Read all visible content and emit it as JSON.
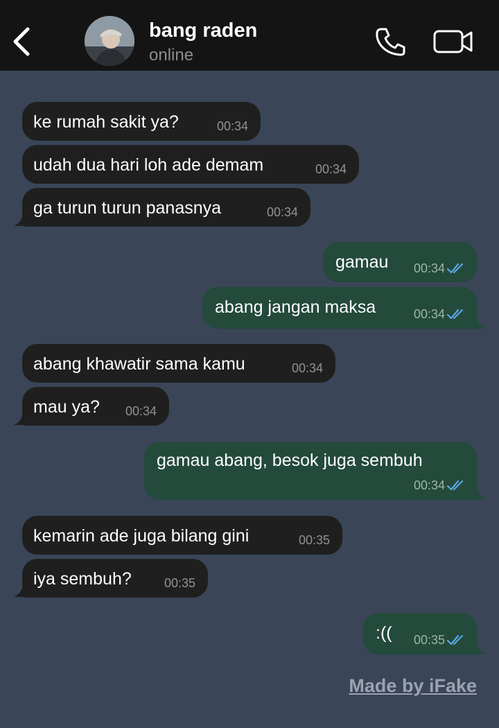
{
  "header": {
    "contact_name": "bang raden",
    "status": "online",
    "icons": [
      "chevron-left-icon",
      "phone-icon",
      "video-camera-icon"
    ]
  },
  "messages": [
    {
      "side": "in",
      "text": "ke rumah sakit ya?",
      "time": "00:34"
    },
    {
      "side": "in",
      "text": "udah dua hari loh ade demam",
      "time": "00:34"
    },
    {
      "side": "in",
      "text": "ga turun turun panasnya",
      "time": "00:34"
    },
    {
      "side": "out",
      "text": "gamau",
      "time": "00:34",
      "read": true
    },
    {
      "side": "out",
      "text": "abang jangan maksa",
      "time": "00:34",
      "read": true
    },
    {
      "side": "in",
      "text": "abang khawatir sama kamu",
      "time": "00:34"
    },
    {
      "side": "in",
      "text": "mau ya?",
      "time": "00:34"
    },
    {
      "side": "out",
      "text": "gamau abang, besok juga sembuh",
      "time": "00:34",
      "read": true
    },
    {
      "side": "in",
      "text": "kemarin ade juga bilang gini",
      "time": "00:35"
    },
    {
      "side": "in",
      "text": "iya sembuh?",
      "time": "00:35"
    },
    {
      "side": "out",
      "text": ":((",
      "time": "00:35",
      "read": true
    }
  ],
  "watermark": "Made by iFake",
  "colors": {
    "background": "#3a4558",
    "header": "#141414",
    "incoming_bubble": "#1f1f1f",
    "outgoing_bubble": "#234a3b",
    "read_tick": "#5aa7e6"
  }
}
